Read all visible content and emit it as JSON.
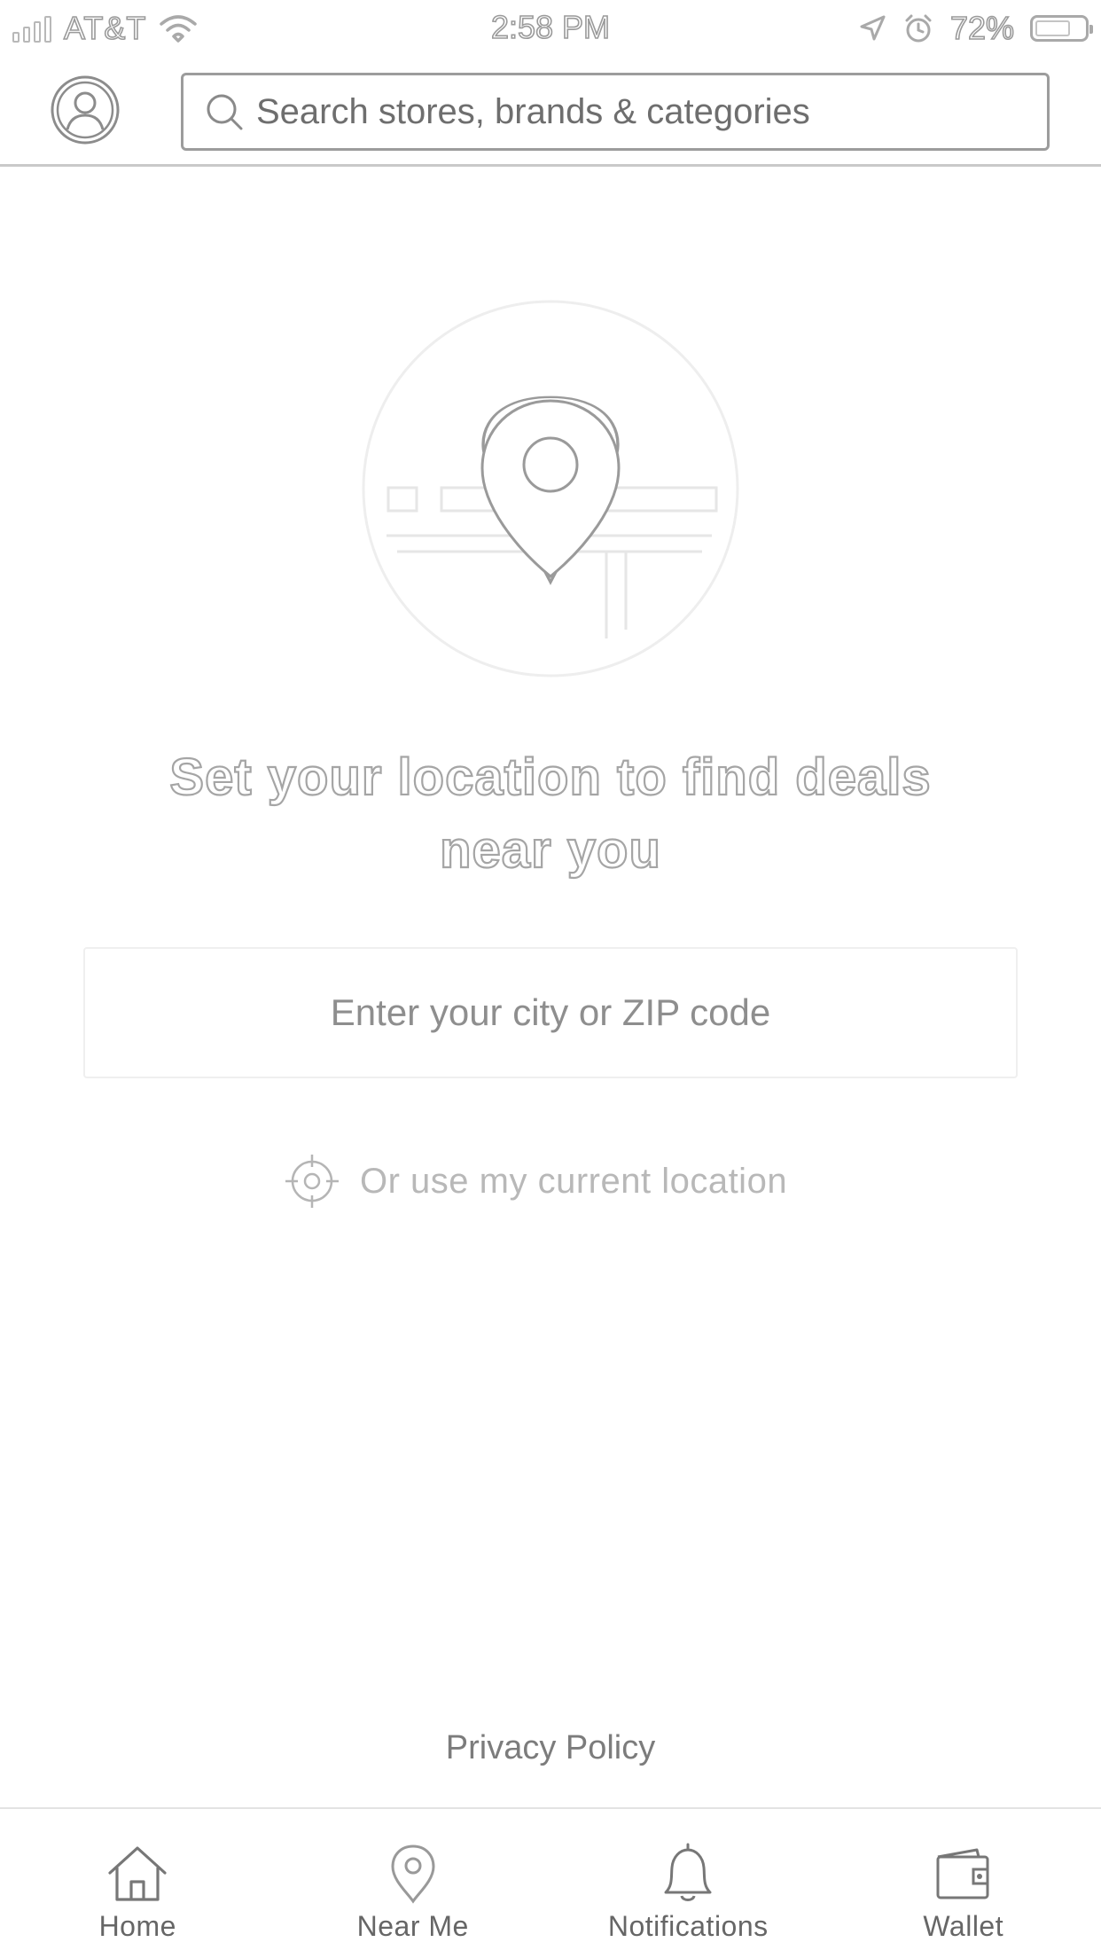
{
  "status_bar": {
    "carrier": "AT&T",
    "time": "2:58 PM",
    "battery_percent": "72%",
    "battery_level": 0.72,
    "icons": [
      "signal-icon",
      "wifi-icon",
      "location-arrow-icon",
      "alarm-icon",
      "battery-icon"
    ]
  },
  "header": {
    "avatar_icon": "user-avatar-icon",
    "search": {
      "icon": "search-icon",
      "placeholder": "Search stores, brands & categories"
    }
  },
  "main": {
    "illustration_icon": "map-pin-illustration",
    "headline": "Set your location to find deals near you",
    "location_input": {
      "placeholder": "Enter your city or ZIP code"
    },
    "current_location": {
      "icon": "crosshair-icon",
      "label": "Or use my current location"
    },
    "privacy_policy": "Privacy Policy"
  },
  "tab_bar": {
    "tabs": [
      {
        "label": "Home",
        "icon": "home-icon"
      },
      {
        "label": "Near Me",
        "icon": "map-pin-icon"
      },
      {
        "label": "Notifications",
        "icon": "bell-icon"
      },
      {
        "label": "Wallet",
        "icon": "wallet-icon"
      }
    ]
  },
  "colors": {
    "background": "#ffffff",
    "text": "#8a8a8a",
    "border": "#9c9c9c",
    "divider": "#e3e3e3"
  }
}
